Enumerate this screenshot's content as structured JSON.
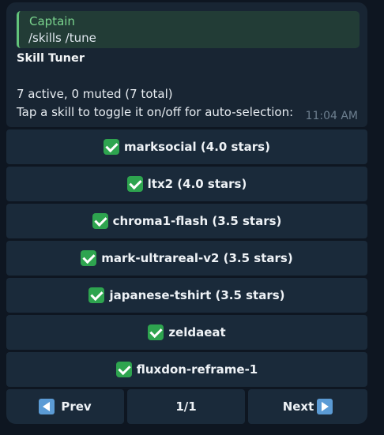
{
  "message": {
    "reply": {
      "author": "Captain",
      "text": "/skills /tune"
    },
    "title": "Skill Tuner",
    "status_line": "7 active, 0 muted (7 total)",
    "instruction": "Tap a skill to toggle it on/off for auto-selection:",
    "time": "11:04 AM"
  },
  "skills": [
    {
      "label": "marksocial (4.0 stars)",
      "enabled": true
    },
    {
      "label": "ltx2 (4.0 stars)",
      "enabled": true
    },
    {
      "label": "chroma1-flash (3.5 stars)",
      "enabled": true
    },
    {
      "label": "mark-ultrareal-v2 (3.5 stars)",
      "enabled": true
    },
    {
      "label": "japanese-tshirt (3.5 stars)",
      "enabled": true
    },
    {
      "label": "zeldaeat",
      "enabled": true
    },
    {
      "label": "fluxdon-reframe-1",
      "enabled": true
    }
  ],
  "pagination": {
    "prev_label": "Prev",
    "page_label": "1/1",
    "next_label": "Next"
  },
  "colors": {
    "background": "#0e1621",
    "bubble": "#182533",
    "button": "#1a2a3a",
    "reply_accent": "#62c37b",
    "check": "#2ea44f",
    "arrow": "#5b9bd5"
  },
  "icons": {
    "skill_status": "check-mark-button-icon",
    "prev": "left-arrow-icon",
    "next": "right-arrow-icon"
  }
}
